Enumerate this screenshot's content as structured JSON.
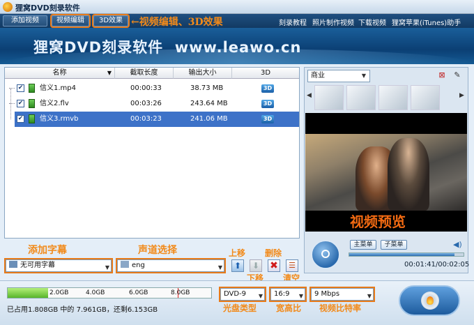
{
  "window": {
    "title": "狸窝DVD刻录软件"
  },
  "menubar": {
    "left": [
      "添加视频",
      "视频编辑",
      "3D效果"
    ],
    "annotation": "←视频编辑、3D效果",
    "right": [
      "刻录教程",
      "照片制作视频",
      "下载视频",
      "狸窝苹果(iTunes)助手"
    ]
  },
  "banner": {
    "text": "狸窝DVD刻录软件  www.leawo.cn"
  },
  "table": {
    "headers": [
      "名称",
      "截取长度",
      "输出大小",
      "3D"
    ],
    "rows": [
      {
        "name": "信义1.mp4",
        "length": "00:00:33",
        "size": "38.73 MB",
        "badge": "3D",
        "selected": false
      },
      {
        "name": "信义2.flv",
        "length": "00:03:26",
        "size": "243.64 MB",
        "badge": "3D",
        "selected": false
      },
      {
        "name": "信义3.rmvb",
        "length": "00:03:23",
        "size": "241.06 MB",
        "badge": "3D",
        "selected": true
      }
    ]
  },
  "template": {
    "selected": "商业"
  },
  "preview": {
    "overlay": "视频预览",
    "main_menu": "主菜单",
    "sub_menu": "子菜单",
    "time": "00:01:41/00:02:05",
    "progress": 0.92
  },
  "subtitle": {
    "label": "添加字幕",
    "value": "无可用字幕"
  },
  "audio": {
    "label": "声道选择",
    "value": "eng"
  },
  "actions": {
    "up": "上移",
    "down": "下移",
    "delete": "删除",
    "clear": "清空"
  },
  "disk": {
    "ticks": [
      "2.0GB",
      "4.0GB",
      "6.0GB",
      "8.0GB"
    ],
    "used_fraction": 0.2,
    "status": "已占用1.808GB 中的 7.961GB，还剩6.153GB"
  },
  "options": {
    "disc_type": "DVD-9",
    "disc_type_label": "光盘类型",
    "aspect": "16:9",
    "aspect_label": "宽高比",
    "bitrate": "9 Mbps",
    "bitrate_label": "视频比特率"
  },
  "colors": {
    "accent": "#e87a18",
    "selection": "#3d72c8",
    "banner": "#0b3f74"
  }
}
